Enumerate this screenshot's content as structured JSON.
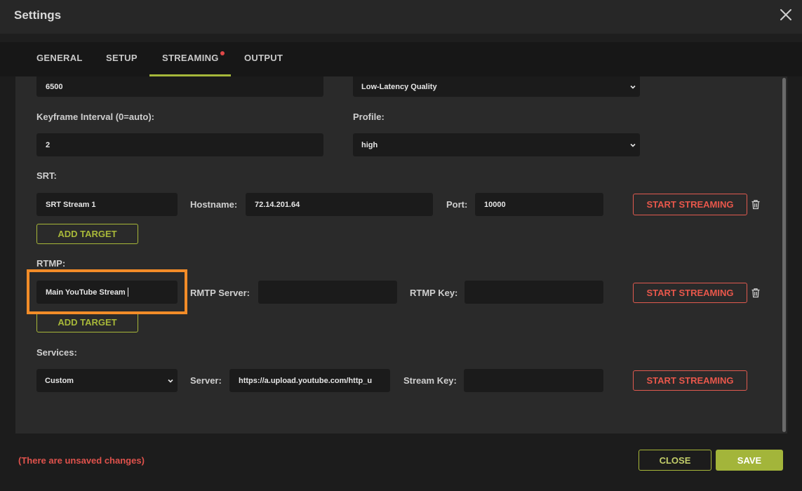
{
  "window": {
    "title": "Settings"
  },
  "tabs": [
    {
      "label": "GENERAL"
    },
    {
      "label": "SETUP"
    },
    {
      "label": "STREAMING",
      "active": true,
      "has_unsaved_dot": true
    },
    {
      "label": "OUTPUT"
    }
  ],
  "encoder": {
    "bitrate_value": "6500",
    "preset_selected": "Low-Latency Quality",
    "keyframe_label": "Keyframe Interval (0=auto):",
    "keyframe_value": "2",
    "profile_label": "Profile:",
    "profile_selected": "high"
  },
  "srt": {
    "section_label": "SRT:",
    "target_name": "SRT Stream 1",
    "hostname_label": "Hostname:",
    "hostname_value": "72.14.201.64",
    "port_label": "Port:",
    "port_value": "10000",
    "start_label": "START STREAMING",
    "add_target_label": "ADD TARGET"
  },
  "rtmp": {
    "section_label": "RTMP:",
    "target_name": "Main YouTube Stream",
    "server_label": "RMTP Server:",
    "server_value": "",
    "key_label": "RTMP Key:",
    "key_value": "",
    "start_label": "START STREAMING",
    "add_target_label": "ADD TARGET"
  },
  "services": {
    "section_label": "Services:",
    "service_selected": "Custom",
    "server_label": "Server:",
    "server_value": "https://a.upload.youtube.com/http_u",
    "stream_key_label": "Stream Key:",
    "stream_key_value": "",
    "start_label": "START STREAMING"
  },
  "footer": {
    "unsaved_note": "(There are unsaved changes)",
    "close_label": "CLOSE",
    "save_label": "SAVE"
  },
  "colors": {
    "accent_green": "#a8b839",
    "danger_red": "#e8574b",
    "highlight_orange": "#f28c28",
    "field_bg": "#1b1b1b",
    "panel_bg": "#2a2a2a"
  }
}
